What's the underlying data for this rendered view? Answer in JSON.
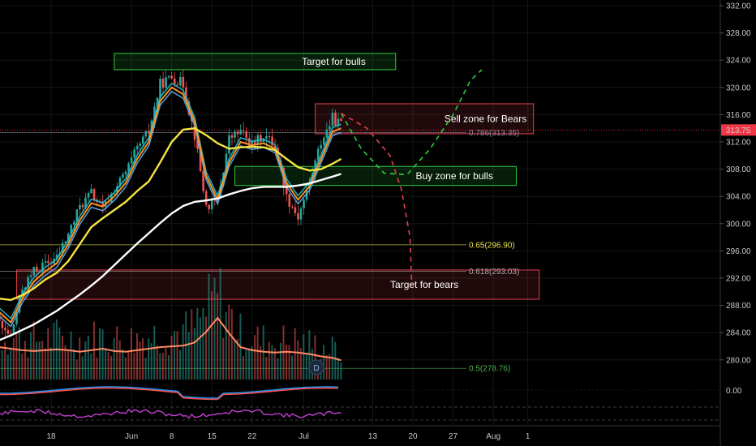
{
  "chart_data": {
    "type": "candlestick",
    "price_axis": {
      "ylim": [
        276,
        332
      ],
      "ticks": [
        332,
        328,
        324,
        320,
        316,
        312,
        308,
        304,
        300,
        296,
        292,
        288,
        284,
        280
      ],
      "tick_labels": [
        "332.00",
        "328.00",
        "324.00",
        "320.00",
        "316.00",
        "312.00",
        "308.00",
        "304.00",
        "300.00",
        "296.00",
        "292.00",
        "288.00",
        "284.00",
        "280.00"
      ],
      "indicator_tick_label": "0.00"
    },
    "time_axis": {
      "labels": [
        "18",
        "Jun",
        "8",
        "15",
        "22",
        "Jul",
        "13",
        "20",
        "27",
        "Aug",
        "1"
      ],
      "label_days": [
        18,
        32,
        39,
        46,
        53,
        62,
        74,
        81,
        88,
        95,
        101
      ]
    },
    "last_price": {
      "value": 313.75,
      "label": "313.75",
      "color": "#f23645"
    },
    "zones": [
      {
        "name": "target-bulls",
        "label": "Target for bulls",
        "price_low": 322.6,
        "price_high": 325.0,
        "day_start": 29,
        "day_end": 78,
        "color": "#2ecc40"
      },
      {
        "name": "sell-zone",
        "label": "Sell zone for Bears",
        "price_low": 313.2,
        "price_high": 317.6,
        "day_start": 64,
        "day_end": 102,
        "color": "#e0404a"
      },
      {
        "name": "buy-zone",
        "label": "Buy zone for bulls",
        "price_low": 305.6,
        "price_high": 308.4,
        "day_start": 50,
        "day_end": 99,
        "color": "#2ecc40"
      },
      {
        "name": "target-bears",
        "label": "Target for bears",
        "price_low": 288.9,
        "price_high": 293.2,
        "day_start": 12,
        "day_end": 103,
        "color": "#e0404a"
      }
    ],
    "fib_levels": [
      {
        "ratio": "0.786",
        "label": "0.786(313.35)",
        "price": 313.35,
        "color": "#8a8aa8"
      },
      {
        "ratio": "0.65",
        "label": "0.65(296.90)",
        "price": 296.9,
        "color": "#e8e04a"
      },
      {
        "ratio": "0.618",
        "label": "0.618(293.03)",
        "price": 293.03,
        "color": "#a8a8a8"
      },
      {
        "ratio": "0.5",
        "label": "0.5(278.76)",
        "price": 278.76,
        "color": "#4caf50"
      }
    ],
    "projections": [
      {
        "name": "bullish-path",
        "color": "#2ecc40",
        "points": [
          [
            68.5,
            316.2
          ],
          [
            72,
            311
          ],
          [
            76,
            307.4
          ],
          [
            80,
            307.2
          ],
          [
            84,
            311
          ],
          [
            88,
            316
          ],
          [
            91,
            321
          ],
          [
            93,
            322.6
          ]
        ]
      },
      {
        "name": "bearish-path",
        "color": "#e0404a",
        "points": [
          [
            68.5,
            316.2
          ],
          [
            73,
            314
          ],
          [
            77,
            310
          ],
          [
            79,
            305
          ],
          [
            80.5,
            298
          ],
          [
            80.8,
            290.8
          ]
        ]
      }
    ],
    "price_series": {
      "days": [
        5,
        7,
        9,
        11,
        13,
        15,
        17,
        19,
        21,
        23,
        25,
        27,
        29,
        31,
        33,
        35,
        37,
        39,
        41,
        43,
        45,
        47,
        49,
        51,
        53,
        55,
        57,
        59,
        61,
        63,
        65,
        67,
        68.5
      ],
      "close": [
        294,
        292.5,
        285,
        283.5,
        290.5,
        293,
        294,
        295,
        298.5,
        302.5,
        304.5,
        302,
        305,
        307.5,
        311,
        313.5,
        320.5,
        321.5,
        320.5,
        313,
        302.5,
        303.5,
        312.5,
        313.5,
        311.5,
        313,
        311.5,
        304,
        301,
        306,
        312,
        315.5,
        314.5
      ],
      "high": [
        295,
        294,
        287,
        285,
        292,
        295,
        296,
        297.5,
        300.5,
        304.5,
        306,
        304,
        307,
        309.5,
        313,
        316,
        323,
        323.5,
        322,
        315,
        305,
        306,
        314.5,
        315,
        313.5,
        315,
        313.5,
        306,
        303.5,
        308,
        314,
        317.5,
        317
      ]
    },
    "moving_averages": [
      {
        "name": "ma-fast",
        "color": "#f7931e",
        "values": [
          292,
          290,
          287,
          285.5,
          289,
          291.5,
          293,
          294.2,
          297,
          300.5,
          303,
          302.5,
          304,
          306,
          309.5,
          312,
          318,
          320,
          319,
          315,
          307,
          303.5,
          309,
          312,
          311.5,
          311.8,
          311,
          306,
          303.5,
          305.5,
          309.5,
          313.5,
          314
        ]
      },
      {
        "name": "ma-mid",
        "color": "#f5e642",
        "values": [
          290,
          289.8,
          289,
          288.8,
          289.5,
          290.5,
          291.8,
          292.8,
          294.5,
          297,
          299.5,
          300.8,
          302,
          303.2,
          304.8,
          306.2,
          309,
          312,
          313.8,
          314,
          313,
          311.8,
          311,
          311.2,
          311.3,
          311.2,
          310.8,
          309.5,
          308.3,
          307.8,
          308,
          308.8,
          309.5
        ]
      },
      {
        "name": "ma-slow",
        "color": "#ffffff",
        "values": [
          281.8,
          282.2,
          282.9,
          283.6,
          284.4,
          285.2,
          286.2,
          287.2,
          288.4,
          289.6,
          290.9,
          292.3,
          293.9,
          295.5,
          297.1,
          298.6,
          300.1,
          301.5,
          302.6,
          303.2,
          303.4,
          303.7,
          304.3,
          304.8,
          305.2,
          305.4,
          305.4,
          305.4,
          305.6,
          305.9,
          306.4,
          306.9,
          307.3
        ]
      }
    ],
    "volume_ma_color": "#ff8a65",
    "volume_ma": [
      0.35,
      0.4,
      0.42,
      0.4,
      0.38,
      0.37,
      0.38,
      0.39,
      0.38,
      0.36,
      0.38,
      0.4,
      0.37,
      0.36,
      0.38,
      0.4,
      0.42,
      0.43,
      0.44,
      0.48,
      0.62,
      0.8,
      0.6,
      0.42,
      0.38,
      0.36,
      0.35,
      0.36,
      0.35,
      0.33,
      0.3,
      0.28,
      0.25
    ],
    "volume_badge": "D",
    "oscillator": {
      "colors": [
        "#2196f3",
        "#ff5252"
      ]
    },
    "rsi": {
      "color": "#c040d0"
    }
  }
}
